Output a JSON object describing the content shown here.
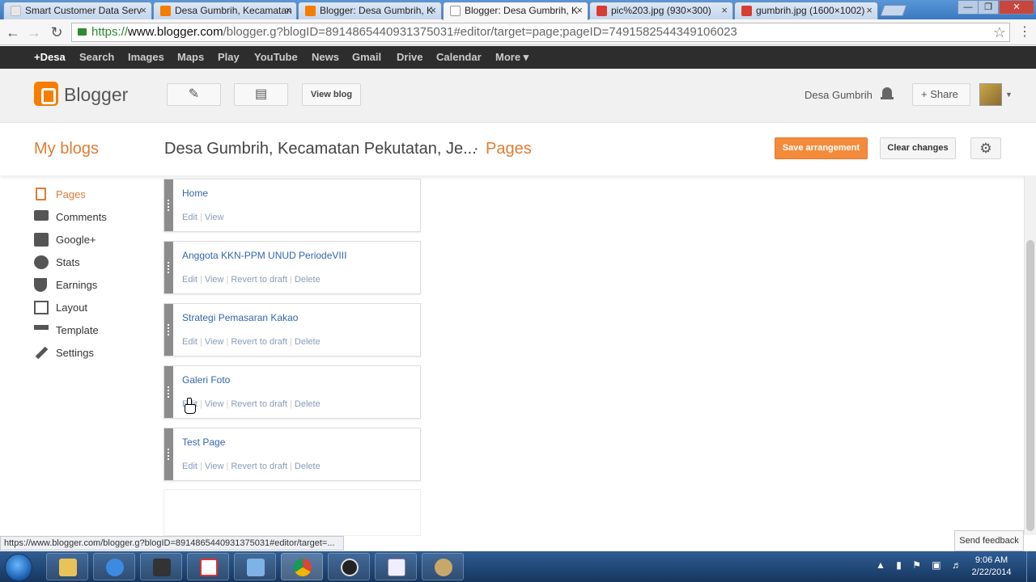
{
  "browser": {
    "tabs": [
      {
        "label": "Smart Customer Data Serv",
        "favicon": "g-icon"
      },
      {
        "label": "Desa Gumbrih, Kecamatan",
        "favicon": "blogger-icon"
      },
      {
        "label": "Blogger: Desa Gumbrih, K",
        "favicon": "blogger-icon"
      },
      {
        "label": "Blogger: Desa Gumbrih, K",
        "favicon": "document-icon",
        "active": true
      },
      {
        "label": "pic%203.jpg (930×300)",
        "favicon": "gplus-icon"
      },
      {
        "label": "gumbrih.jpg (1600×1002)",
        "favicon": "gplus-icon"
      }
    ],
    "close_glyph": "×",
    "window_controls": {
      "minimize": "—",
      "maximize": "❐",
      "close": "✕"
    },
    "url": {
      "scheme": "https://",
      "host": "www.blogger.com",
      "path": "/blogger.g?blogID=8914865440931375031#editor/target=page;pageID=7491582544349106023"
    }
  },
  "google_bar": {
    "items": [
      "+Desa",
      "Search",
      "Images",
      "Maps",
      "Play",
      "YouTube",
      "News",
      "Gmail",
      "Drive",
      "Calendar",
      "More ▾"
    ]
  },
  "blogger_header": {
    "brand": "Blogger",
    "view_blog_label": "View blog",
    "user_name": "Desa Gumbrih",
    "share_label": "Share"
  },
  "subheader": {
    "my_blogs": "My blogs",
    "blog_name": "Desa Gumbrih, Kecamatan Pekutatan, Je...",
    "separator": "·",
    "section": "Pages",
    "save_label": "Save arrangement",
    "clear_label": "Clear changes"
  },
  "sidebar": {
    "items": [
      {
        "label": "Pages",
        "icon": "pages-icon",
        "active": true
      },
      {
        "label": "Comments",
        "icon": "comments-icon"
      },
      {
        "label": "Google+",
        "icon": "google-plus-icon"
      },
      {
        "label": "Stats",
        "icon": "stats-icon"
      },
      {
        "label": "Earnings",
        "icon": "earnings-icon"
      },
      {
        "label": "Layout",
        "icon": "layout-icon"
      },
      {
        "label": "Template",
        "icon": "template-icon"
      },
      {
        "label": "Settings",
        "icon": "settings-icon"
      }
    ]
  },
  "pages": [
    {
      "title": "Home",
      "actions": [
        "Edit",
        "View"
      ]
    },
    {
      "title": "Anggota KKN-PPM UNUD PeriodeVIII",
      "actions": [
        "Edit",
        "View",
        "Revert to draft",
        "Delete"
      ]
    },
    {
      "title": "Strategi Pemasaran Kakao",
      "actions": [
        "Edit",
        "View",
        "Revert to draft",
        "Delete"
      ]
    },
    {
      "title": "Galeri Foto",
      "actions": [
        "Edit",
        "View",
        "Revert to draft",
        "Delete"
      ]
    },
    {
      "title": "Test Page",
      "actions": [
        "Edit",
        "View",
        "Revert to draft",
        "Delete"
      ]
    }
  ],
  "status_url": "https://www.blogger.com/blogger.g?blogID=8914865440931375031#editor/target=...",
  "feedback_label": "Send feedback",
  "taskbar": {
    "clock_time": "9:06 AM",
    "clock_date": "2/22/2014",
    "tray_glyph": "▲"
  },
  "colors": {
    "accent": "#dd7d34",
    "save_button": "#f48b3b",
    "link": "#3366aa"
  }
}
